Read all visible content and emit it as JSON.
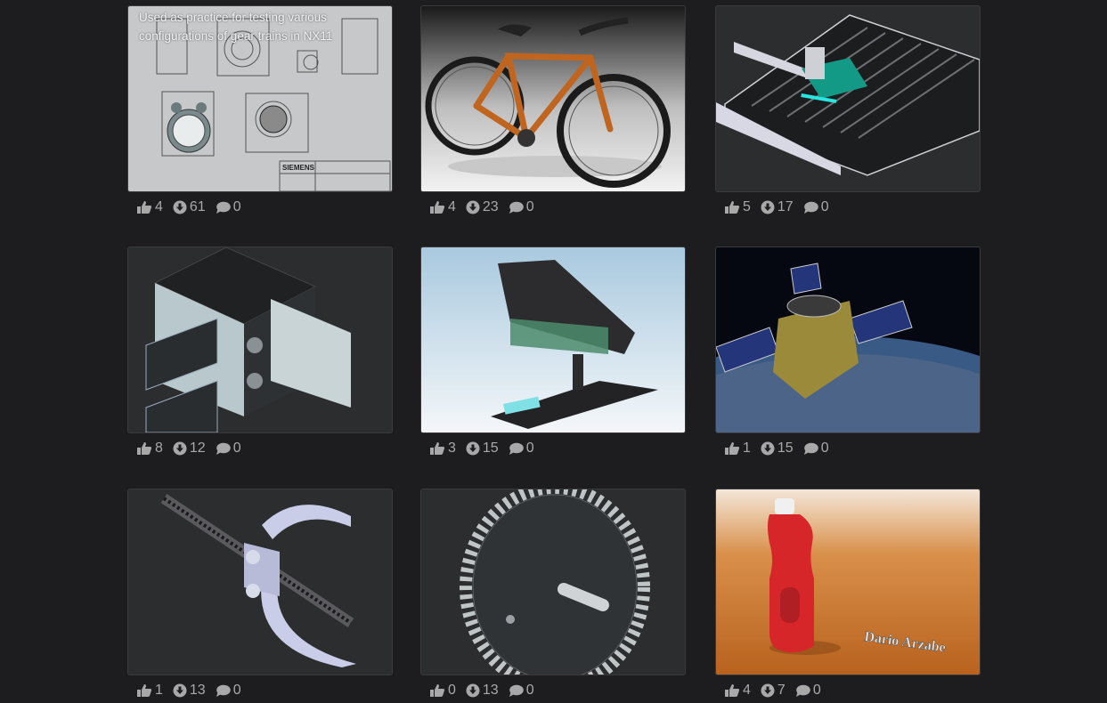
{
  "colors": {
    "background": "#1d1d1f",
    "stat_text": "#a8a8a8",
    "card_border": "#3a3a3c"
  },
  "cards": [
    {
      "caption": "Used as practice for testing various configurations of gear trains in NX11",
      "likes": "4",
      "downloads": "61",
      "comments": "0",
      "image_watermark": "SIEMENS"
    },
    {
      "caption": "",
      "likes": "4",
      "downloads": "23",
      "comments": "0"
    },
    {
      "caption": "",
      "likes": "5",
      "downloads": "17",
      "comments": "0"
    },
    {
      "caption": "",
      "likes": "8",
      "downloads": "12",
      "comments": "0"
    },
    {
      "caption": "",
      "likes": "3",
      "downloads": "15",
      "comments": "0"
    },
    {
      "caption": "",
      "likes": "1",
      "downloads": "15",
      "comments": "0"
    },
    {
      "caption": "",
      "likes": "1",
      "downloads": "13",
      "comments": "0"
    },
    {
      "caption": "",
      "likes": "0",
      "downloads": "13",
      "comments": "0"
    },
    {
      "caption": "",
      "likes": "4",
      "downloads": "7",
      "comments": "0",
      "image_watermark": "Dario Arzabe"
    }
  ],
  "icons": {
    "like": "thumbs-up-icon",
    "download": "download-circle-icon",
    "comment": "comment-bubble-icon"
  }
}
